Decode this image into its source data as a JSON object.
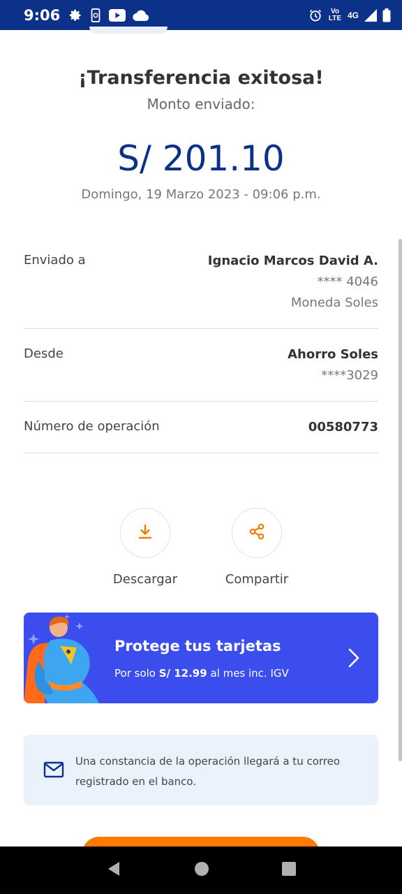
{
  "status_bar": {
    "time": "9:06",
    "network": "4G",
    "volte": "Vo LTE",
    "icons_left": [
      "gear-icon",
      "phone-sync-icon",
      "youtube-icon",
      "cloud-icon"
    ],
    "icons_right": [
      "alarm-icon",
      "volte-icon",
      "signal-icon",
      "battery-icon"
    ]
  },
  "header": {
    "title": "¡Transferencia exitosa!",
    "subtitle": "Monto enviado:",
    "amount": "S/ 201.10",
    "datetime": "Domingo, 19 Marzo 2023 - 09:06 p.m."
  },
  "details": {
    "sent_to": {
      "label": "Enviado a",
      "name": "Ignacio Marcos David A.",
      "account": "**** 4046",
      "currency": "Moneda Soles"
    },
    "from": {
      "label": "Desde",
      "account_name": "Ahorro Soles",
      "account": "****3029"
    },
    "operation": {
      "label": "Número de operación",
      "number": "00580773"
    }
  },
  "actions": {
    "download_label": "Descargar",
    "share_label": "Compartir"
  },
  "promo": {
    "title": "Protege tus tarjetas",
    "text_prefix": "Por solo ",
    "price": "S/ 12.99",
    "text_suffix": " al mes inc. IGV"
  },
  "notice": {
    "text": "Una constancia de la operación llegará a tu correo registrado en el banco."
  },
  "colors": {
    "brand_blue": "#0b3189",
    "promo_blue": "#3b4ded",
    "accent_orange": "#ff7a00",
    "notice_bg": "#eaf3fc"
  }
}
